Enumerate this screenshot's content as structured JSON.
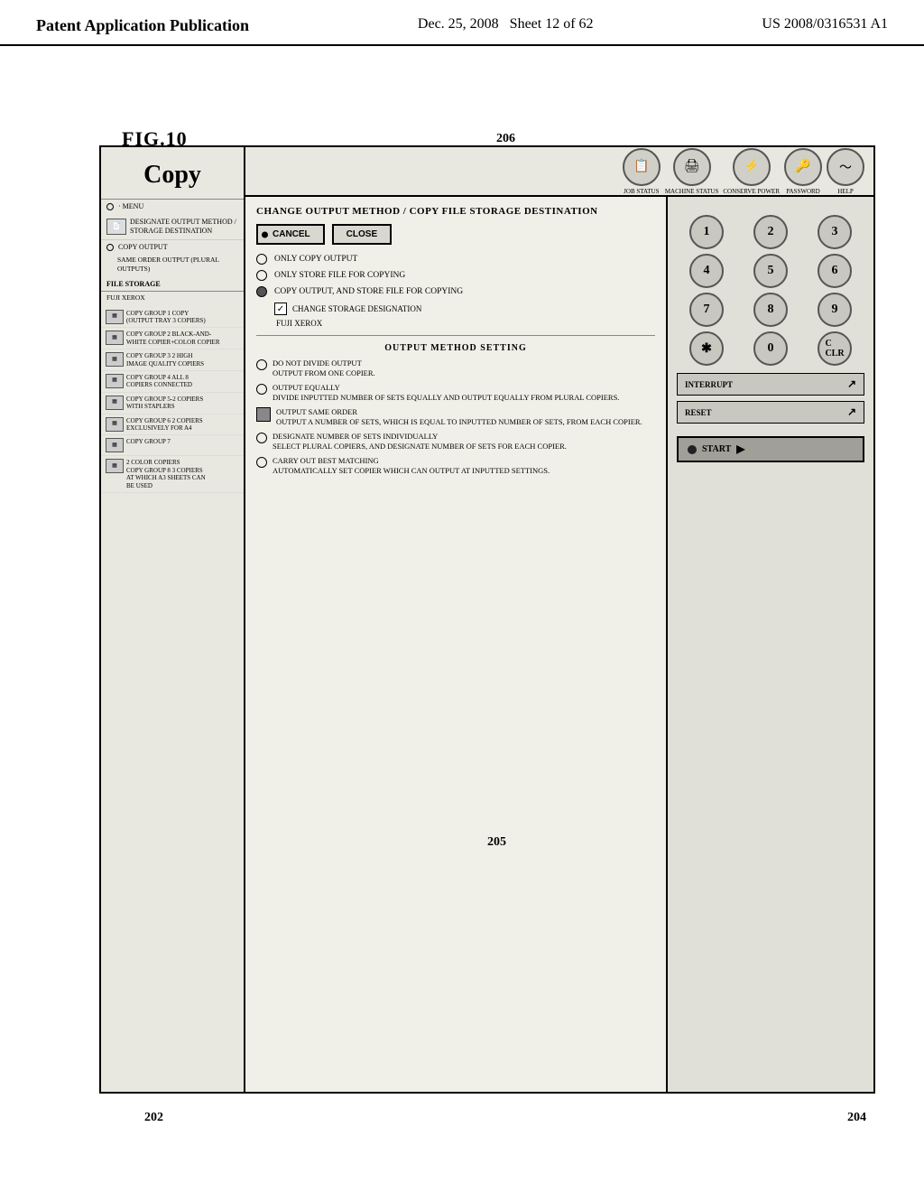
{
  "header": {
    "left": "Patent Application Publication",
    "center_date": "Dec. 25, 2008",
    "center_sheet": "Sheet 12 of 62",
    "right": "US 2008/0316531 A1"
  },
  "figure": {
    "label": "FIG.10"
  },
  "toolbar": {
    "buttons": [
      {
        "label": "JOB STATUS",
        "icon": "📋"
      },
      {
        "label": "MACHINE STATUS",
        "icon": "🖨"
      },
      {
        "label": "CONSERVE POWER",
        "icon": "⚡"
      },
      {
        "label": "PASSWORD",
        "icon": "🔑"
      },
      {
        "label": "HELP",
        "icon": "〜"
      }
    ]
  },
  "copy": {
    "title": "Copy",
    "menu_label": "· MENU",
    "designate_item": "DESIGNATE OUTPUT METHOD / STORAGE DESTINATION",
    "copy_output": "COPY OUTPUT",
    "same_order": "SAME ORDER OUTPUT (PLURAL OUTPUTS)",
    "file_storage": "FILE STORAGE",
    "fuji_xerox_menu": "FUJI XEROX"
  },
  "dialog": {
    "title": "CHANGE OUTPUT METHOD / COPY FILE STORAGE DESTINATION",
    "cancel_btn": "CANCEL",
    "close_btn": "CLOSE",
    "only_copy": "ONLY COPY OUTPUT",
    "only_store": "ONLY STORE FILE FOR COPYING",
    "copy_output": "COPY OUTPUT, AND STORE FILE FOR COPYING",
    "change_storage": "CHANGE STORAGE DESIGNATION",
    "fuji_xerox": "FUJI XEROX"
  },
  "output_method": {
    "title": "OUTPUT METHOD SETTING",
    "rows": [
      {
        "label": "DO NOT DIVIDE OUTPUT\nOUTPUT FROM ONE COPIER."
      },
      {
        "label": "OUTPUT EQUALLY\nDIVIDE INPUTTED NUMBER OF SETS EQUALLY AND OUTPUT EQUALLY FROM PLURAL COPIERS."
      },
      {
        "label": "OUTPUT SAME ORDER\nOUTPUT A NUMBER OF SETS, WHICH IS EQUAL TO INPUTTED NUMBER OF SETS, FROM EACH COPIER."
      },
      {
        "label": "DESIGNATE NUMBER OF SETS INDIVIDUALLY\nSELECT PLURAL COPIERS, AND DESIGNATE NUMBER OF SETS FOR EACH COPIER."
      },
      {
        "label": "CARRY OUT BEST MATCHING\nAUTOMATICALLY SET COPIER WHICH CAN OUTPUT AT INPUTTED SETTINGS."
      }
    ]
  },
  "keypad": {
    "keys": [
      "1",
      "2",
      "3",
      "4",
      "5",
      "6",
      "7",
      "8",
      "9",
      "*",
      "0",
      "C/CLEAR"
    ],
    "interrupt": "INTERRUPT",
    "reset": "RESET",
    "start": "START"
  },
  "sidebar_items": [
    {
      "label": "COPY GROUP 1  COPY\n(OUTPUT TRAY 3 COPIERS)"
    },
    {
      "label": "COPY GROUP 2  BLACK-AND-\nWHITE COPIER+COLOR COPIER"
    },
    {
      "label": "COPY GROUP 3  2 HIGH\nIMAGE QUALITY COPIERS"
    },
    {
      "label": "COPY GROUP 4  ALL 8\nCOPIERS CONNECTED"
    },
    {
      "label": "COPY GROUP 5-2 COPIERS\nWITH STAPLERS"
    },
    {
      "label": "COPY GROUP 6  2 COPIERS\nEXCLUSIVELY FOR A4"
    },
    {
      "label": "COPY GROUP 7"
    },
    {
      "label": "2 COLOR COPIERS\nCOPY GROUP 8  3 COPIERS\nAT WHICH A3 SHEETS CAN\nBE USED"
    }
  ],
  "ref_numbers": {
    "r202": "202",
    "r204": "204",
    "r205": "205",
    "r206": "206"
  }
}
